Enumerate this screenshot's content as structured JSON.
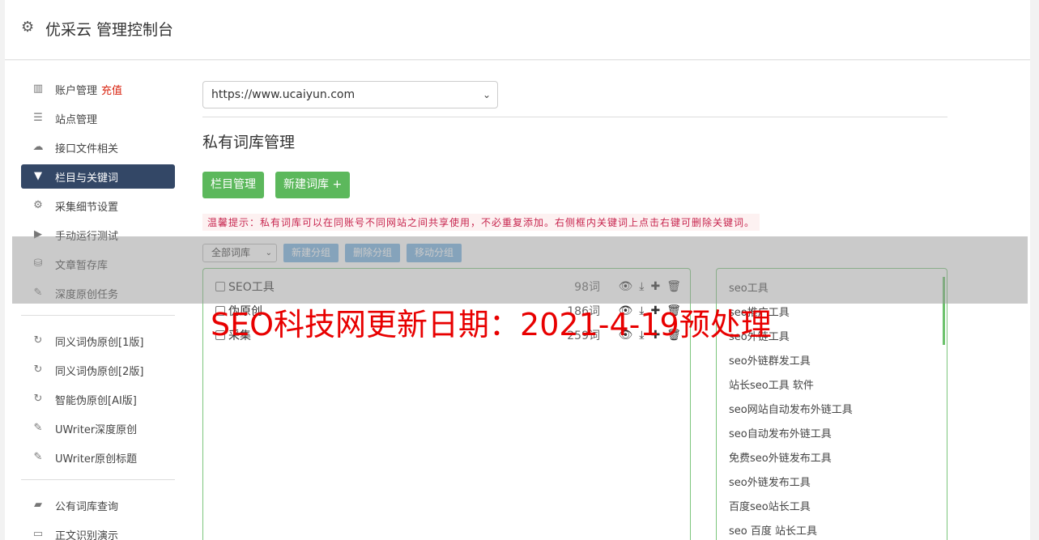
{
  "header": {
    "title": "优采云 管理控制台",
    "icon": "gear-icon"
  },
  "sidebar": {
    "groups": [
      [
        {
          "label": "账户管理",
          "extra": "充值",
          "icon": "bar-chart-icon"
        },
        {
          "label": "站点管理",
          "icon": "server-icon"
        },
        {
          "label": "接口文件相关",
          "icon": "cloud-upload-icon"
        },
        {
          "label": "栏目与关键词",
          "icon": "filter-icon",
          "active": true
        },
        {
          "label": "采集细节设置",
          "icon": "gears-icon"
        },
        {
          "label": "手动运行测试",
          "icon": "play-icon"
        },
        {
          "label": "文章暂存库",
          "icon": "database-icon"
        },
        {
          "label": "深度原创任务",
          "icon": "edit-icon"
        }
      ],
      [
        {
          "label": "同义词伪原创[1版]",
          "icon": "refresh-icon"
        },
        {
          "label": "同义词伪原创[2版]",
          "icon": "refresh-icon"
        },
        {
          "label": "智能伪原创[AI版]",
          "icon": "refresh-icon"
        },
        {
          "label": "UWriter深度原创",
          "icon": "edit-icon"
        },
        {
          "label": "UWriter原创标题",
          "icon": "edit-icon"
        }
      ],
      [
        {
          "label": "公有词库查询",
          "icon": "book-icon"
        },
        {
          "label": "正文识别演示",
          "icon": "monitor-icon"
        }
      ]
    ]
  },
  "content": {
    "site_select": "https://www.ucaiyun.com",
    "section_title": "私有词库管理",
    "btn_columns": "栏目管理",
    "btn_new_lib": "新建词库 +",
    "tip": "温馨提示：私有词库可以在同账号不同网站之间共享使用，不必重复添加。右侧框内关键词上点击右键可删除关键词。",
    "group_select": "全部词库",
    "btn_new_group": "新建分组",
    "btn_delete_group": "删除分组",
    "btn_move_group": "移动分组",
    "libraries": [
      {
        "name": "SEO工具",
        "count": "98词"
      },
      {
        "name": "伪原创",
        "count": "186词"
      },
      {
        "name": "采集",
        "count": "259词"
      }
    ],
    "keywords": [
      "seo工具",
      "seo推广工具",
      "seo外链工具",
      "seo外链群发工具",
      "站长seo工具 软件",
      "seo网站自动发布外链工具",
      "seo自动发布外链工具",
      "免费seo外链发布工具",
      "seo外链发布工具",
      "百度seo站长工具",
      "seo 百度 站长工具"
    ]
  },
  "watermark": "SEO科技网更新日期：2021-4-19预处理",
  "colors": {
    "active_nav": "#334766",
    "green_btn": "#5cb85c",
    "blue_btn": "#75b1e0",
    "watermark": "#e80000",
    "recharge": "#d9230f"
  }
}
